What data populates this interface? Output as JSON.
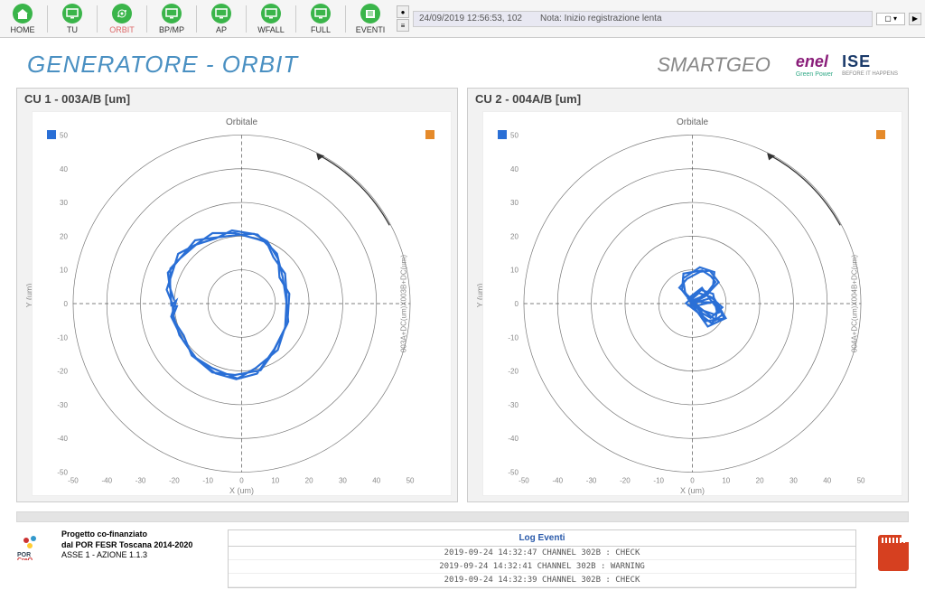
{
  "toolbar": {
    "items": [
      {
        "label": "HOME",
        "icon": "home",
        "active": false
      },
      {
        "label": "TU",
        "icon": "monitor",
        "active": false
      },
      {
        "label": "ORBIT",
        "icon": "orbit",
        "active": true
      },
      {
        "label": "BP/MP",
        "icon": "monitor",
        "active": false
      },
      {
        "label": "AP",
        "icon": "monitor",
        "active": false
      },
      {
        "label": "WFALL",
        "icon": "monitor",
        "active": false
      },
      {
        "label": "FULL",
        "icon": "monitor",
        "active": false
      },
      {
        "label": "EVENTI",
        "icon": "eventi",
        "active": false
      }
    ]
  },
  "status": {
    "timestamp": "24/09/2019 12:56:53, 102",
    "note": "Nota: Inizio registrazione lenta"
  },
  "page_title": "GENERATORE - ORBIT",
  "brand_right": "SMARTGEO",
  "logo_enel": {
    "name": "enel",
    "sub": "Green Power"
  },
  "logo_ise": {
    "name": "ISE",
    "sub": "BEFORE IT HAPPENS"
  },
  "charts": [
    {
      "title": "CU 1 - 003A/B [um]",
      "subtitle": "Orbitale",
      "xlabel": "X (um)",
      "ylabel": "Y (um)",
      "right_label": "003A+DC(um)X003B+DC(um)"
    },
    {
      "title": "CU 2 - 004A/B [um]",
      "subtitle": "Orbitale",
      "xlabel": "X (um)",
      "ylabel": "Y (um)",
      "right_label": "004A+DC(um)X004B+DC(um)"
    }
  ],
  "chart_data": [
    {
      "type": "orbit_polar",
      "title": "CU 1 - 003A/B [um]",
      "subtitle": "Orbitale",
      "xlabel": "X (um)",
      "ylabel": "Y (um)",
      "xlim": [
        -50,
        50
      ],
      "ylim": [
        -50,
        50
      ],
      "ticks": [
        -50,
        -40,
        -30,
        -20,
        -10,
        0,
        10,
        20,
        30,
        40,
        50
      ],
      "rings": [
        10,
        20,
        30,
        40,
        50
      ],
      "rotation": "ccw",
      "legend": [
        {
          "color": "#2a6fd6"
        },
        {
          "color": "#e58a2a"
        }
      ],
      "series": [
        {
          "name": "orbit",
          "color": "#2a6fd6",
          "points": [
            [
              -20,
              0
            ],
            [
              -22,
              5
            ],
            [
              -21,
              10
            ],
            [
              -18,
              14
            ],
            [
              -14,
              18
            ],
            [
              -8,
              20
            ],
            [
              -2,
              21
            ],
            [
              4,
              20
            ],
            [
              8,
              18
            ],
            [
              10,
              14
            ],
            [
              12,
              8
            ],
            [
              14,
              2
            ],
            [
              13,
              -6
            ],
            [
              10,
              -14
            ],
            [
              5,
              -20
            ],
            [
              -2,
              -22
            ],
            [
              -8,
              -20
            ],
            [
              -14,
              -16
            ],
            [
              -18,
              -10
            ],
            [
              -20,
              -4
            ],
            [
              -20,
              0
            ]
          ]
        }
      ]
    },
    {
      "type": "orbit_polar",
      "title": "CU 2 - 004A/B [um]",
      "subtitle": "Orbitale",
      "xlabel": "X (um)",
      "ylabel": "Y (um)",
      "xlim": [
        -50,
        50
      ],
      "ylim": [
        -50,
        50
      ],
      "ticks": [
        -50,
        -40,
        -30,
        -20,
        -10,
        0,
        10,
        20,
        30,
        40,
        50
      ],
      "rings": [
        10,
        20,
        30,
        40,
        50
      ],
      "rotation": "ccw",
      "legend": [
        {
          "color": "#2a6fd6"
        },
        {
          "color": "#e58a2a"
        }
      ],
      "series": [
        {
          "name": "orbit",
          "color": "#2a6fd6",
          "points": [
            [
              0,
              0
            ],
            [
              4,
              3
            ],
            [
              7,
              6
            ],
            [
              6,
              9
            ],
            [
              2,
              10
            ],
            [
              -2,
              8
            ],
            [
              -3,
              4
            ],
            [
              0,
              0
            ],
            [
              3,
              -2
            ],
            [
              6,
              -4
            ],
            [
              8,
              -2
            ],
            [
              6,
              2
            ],
            [
              2,
              4
            ],
            [
              -1,
              1
            ],
            [
              5,
              -6
            ],
            [
              9,
              -4
            ],
            [
              7,
              1
            ],
            [
              0,
              0
            ]
          ]
        }
      ]
    }
  ],
  "footer": {
    "text1": "Progetto co-finanziato",
    "text2": "dal POR FESR Toscana 2014-2020",
    "text3": "ASSE 1 - AZIONE 1.1.3",
    "por_label": "POR CreO"
  },
  "log": {
    "title": "Log Eventi",
    "rows": [
      "2019-09-24 14:32:47 CHANNEL 302B : CHECK",
      "2019-09-24 14:32:41 CHANNEL 302B : WARNING",
      "2019-09-24 14:32:39 CHANNEL 302B : CHECK"
    ]
  }
}
